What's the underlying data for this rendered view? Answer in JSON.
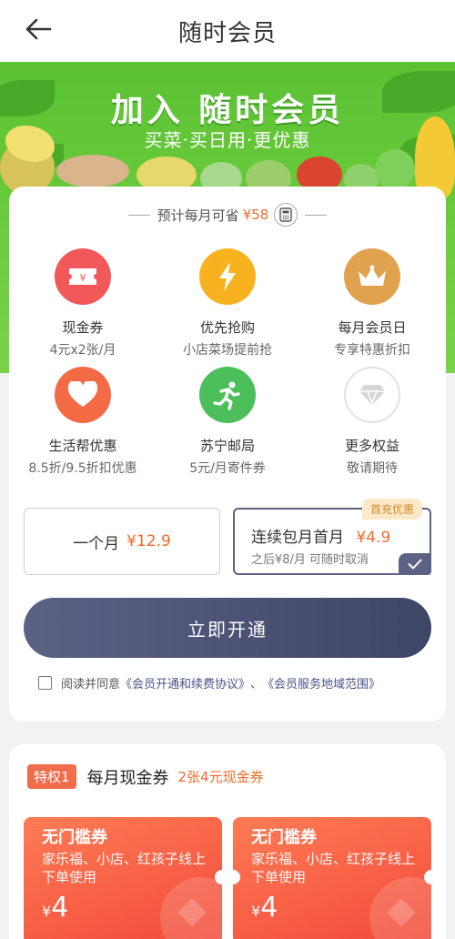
{
  "header": {
    "title": "随时会员"
  },
  "banner": {
    "title": "加入 随时会员",
    "subtitle": "买菜·买日用·更优惠"
  },
  "saving": {
    "label": "预计每月可省",
    "amount": "¥58"
  },
  "benefits": [
    {
      "name": "现金券",
      "desc": "4元x2张/月",
      "icon": "ticket-icon",
      "color": "#f2575a"
    },
    {
      "name": "优先抢购",
      "desc": "小店菜场提前抢",
      "icon": "lightning-icon",
      "color": "#f8b21f"
    },
    {
      "name": "每月会员日",
      "desc": "专享特惠折扣",
      "icon": "crown-icon",
      "color": "#e0a24e"
    },
    {
      "name": "生活帮优惠",
      "desc": "8.5折/9.5折扣优惠",
      "icon": "heart-icon",
      "color": "#f36a45"
    },
    {
      "name": "苏宁邮局",
      "desc": "5元/月寄件券",
      "icon": "runner-icon",
      "color": "#4cbe5a"
    },
    {
      "name": "更多权益",
      "desc": "敬请期待",
      "icon": "gem-icon",
      "color": "#e2e2e2"
    }
  ],
  "plans": {
    "monthly": {
      "label": "一个月",
      "price": "¥12.9"
    },
    "auto": {
      "label": "连续包月首月",
      "price": "¥4.9",
      "note": "之后¥8/月 可随时取消",
      "badge": "首充优惠"
    }
  },
  "open_button": "立即开通",
  "agreement": {
    "prefix": "阅读并同意",
    "link1": "《会员开通和续费协议》",
    "sep": "、",
    "link2": "《会员服务地域范围》"
  },
  "privilege": {
    "tag": "特权1",
    "title": "每月现金券",
    "subtitle": "2张4元现金券",
    "coupons": [
      {
        "title": "无门槛券",
        "desc": "家乐福、小店、红孩子线上下单使用",
        "currency": "¥",
        "value": "4"
      },
      {
        "title": "无门槛券",
        "desc": "家乐福、小店、红孩子线上下单使用",
        "currency": "¥",
        "value": "4"
      }
    ]
  }
}
